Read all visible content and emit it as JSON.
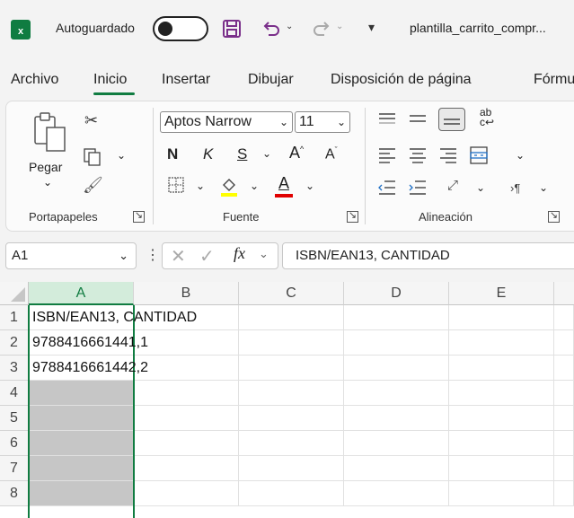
{
  "titlebar": {
    "logo_letter": "x",
    "autosave_label": "Autoguardado",
    "filename": "plantilla_carrito_compr..."
  },
  "tabs": [
    {
      "label": "Archivo"
    },
    {
      "label": "Inicio",
      "active": true
    },
    {
      "label": "Insertar"
    },
    {
      "label": "Dibujar"
    },
    {
      "label": "Disposición de página"
    },
    {
      "label": "Fórmu"
    }
  ],
  "ribbon": {
    "clipboard": {
      "label": "Portapapeles",
      "paste_label": "Pegar"
    },
    "font": {
      "label": "Fuente",
      "font_name": "Aptos Narrow",
      "font_size": "11",
      "bold": "N",
      "italic": "K",
      "underline": "S",
      "grow": "A",
      "shrink": "A",
      "font_color_letter": "A"
    },
    "alignment": {
      "label": "Alineación",
      "wrap_label": "ab"
    }
  },
  "formula_bar": {
    "name_box": "A1",
    "fx": "fx",
    "content": "ISBN/EAN13, CANTIDAD"
  },
  "grid": {
    "columns": [
      "A",
      "B",
      "C",
      "D",
      "E"
    ],
    "selected_column": "A",
    "rows": [
      "1",
      "2",
      "3",
      "4",
      "5",
      "6",
      "7",
      "8"
    ],
    "cells": {
      "A1": "ISBN/EAN13, CANTIDAD",
      "A2": "9788416661441,1",
      "A3": "9788416661442,2"
    }
  },
  "colors": {
    "accent": "#107c41",
    "selection": "#c6c6c6",
    "header_selected": "#d3ecdb"
  }
}
